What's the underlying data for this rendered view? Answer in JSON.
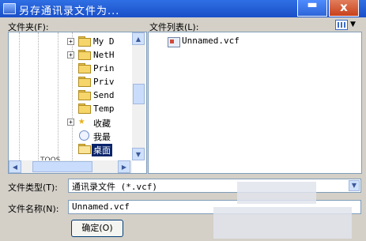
{
  "window": {
    "title": "另存通讯录文件为...",
    "minimize_label": "▬",
    "close_label": "x"
  },
  "folders": {
    "label": "文件夹(F):",
    "items": [
      {
        "name": "My D",
        "expander": "+"
      },
      {
        "name": "NetH",
        "expander": "+"
      },
      {
        "name": "Prin",
        "expander": ""
      },
      {
        "name": "Priv",
        "expander": ""
      },
      {
        "name": "Send",
        "expander": ""
      },
      {
        "name": "Temp",
        "expander": ""
      },
      {
        "name": "收藏",
        "expander": "+"
      },
      {
        "name": "我最",
        "expander": ""
      },
      {
        "name": "桌面",
        "expander": ""
      }
    ],
    "truncated_item": "TOOS"
  },
  "files": {
    "label": "文件列表(L):",
    "items": [
      {
        "name": "Unnamed.vcf"
      }
    ]
  },
  "file_type": {
    "label": "文件类型(T):",
    "value": "通讯录文件 (*.vcf)"
  },
  "file_name": {
    "label": "文件名称(N):",
    "value": "Unnamed.vcf"
  },
  "ok_button": {
    "label": "确定(O)"
  }
}
